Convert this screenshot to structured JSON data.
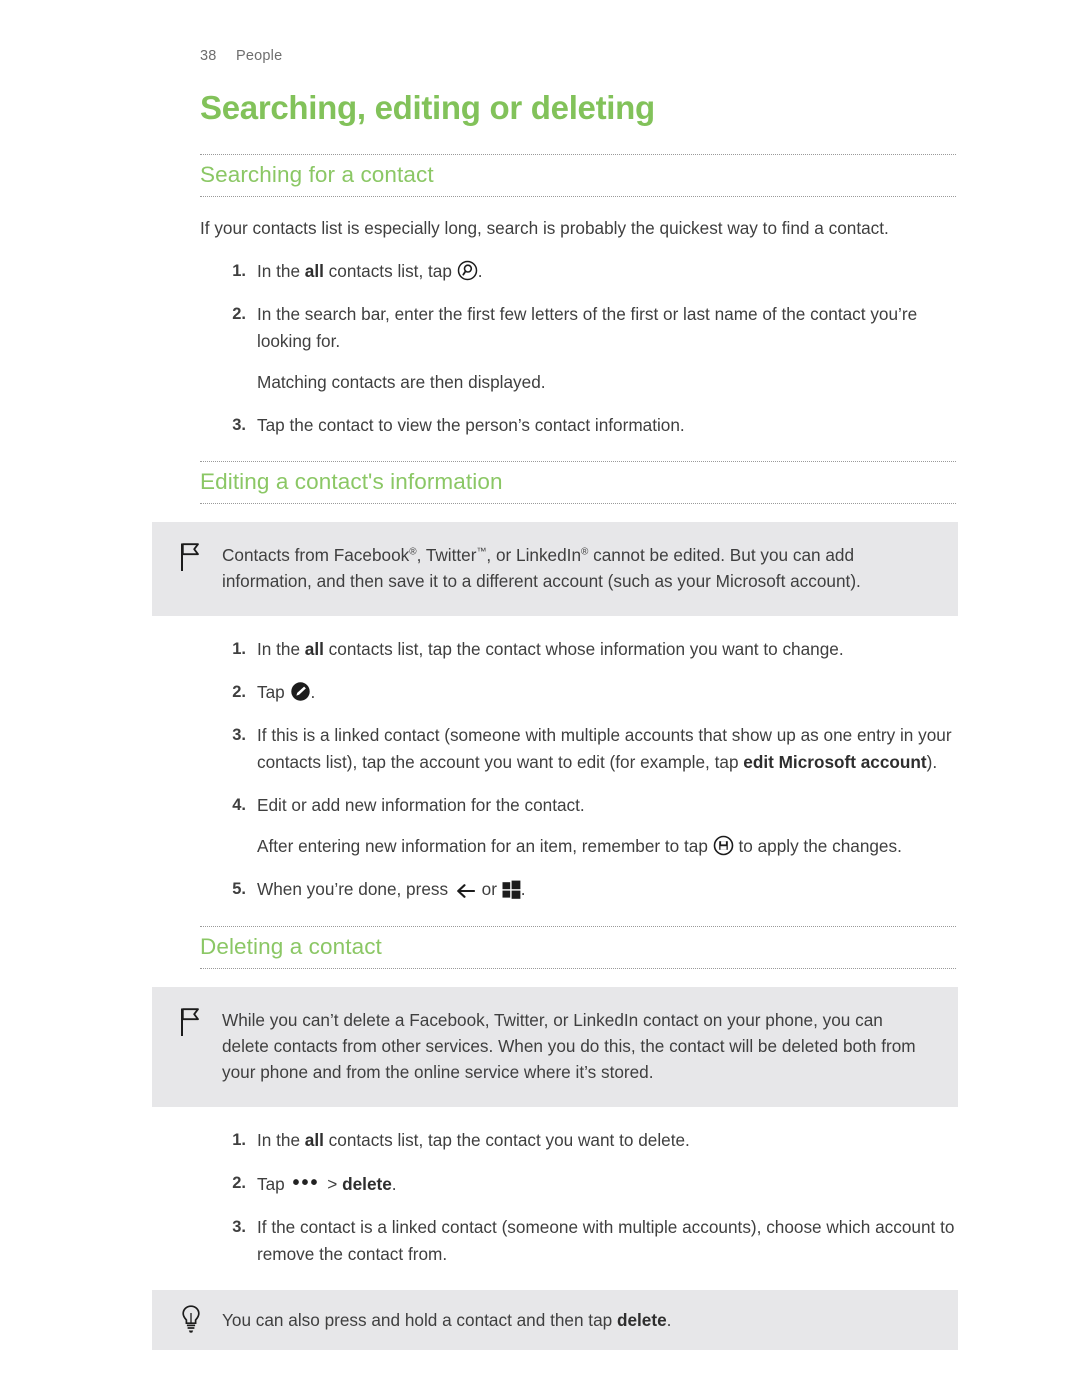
{
  "page": {
    "number": "38",
    "chapter": "People"
  },
  "title": "Searching, editing or deleting",
  "colors": {
    "heading_green": "#82c25a",
    "subheading_green": "#8bc765",
    "callout_bg": "#e7e7e9",
    "body_text": "#3f3f3f",
    "rule": "#9a9a9a"
  },
  "sections": [
    {
      "heading": "Searching for a contact",
      "intro": "If your contacts list is especially long, search is probably the quickest way to find a contact.",
      "steps": [
        {
          "num": "1.",
          "pre": "In the ",
          "bold": "all",
          "mid": " contacts list, tap ",
          "icon": "search-circle-icon",
          "post": "."
        },
        {
          "num": "2.",
          "text": "In the search bar, enter the first few letters of the first or last name of the contact you’re looking for.",
          "substep": "Matching contacts are then displayed."
        },
        {
          "num": "3.",
          "text": "Tap the contact to view the person’s contact information."
        }
      ]
    },
    {
      "heading": "Editing a contact's information",
      "note": {
        "icon": "flag-icon",
        "text_parts": {
          "a": "Contacts from Facebook",
          "sup1": "®",
          "b": ", Twitter",
          "sup2": "™",
          "c": ", or LinkedIn",
          "sup3": "®",
          "d": " cannot be edited. But you can add information, and then save it to a different account (such as your Microsoft account)."
        }
      },
      "steps": [
        {
          "num": "1.",
          "pre": "In the ",
          "bold": "all",
          "post": " contacts list, tap the contact whose information you want to change."
        },
        {
          "num": "2.",
          "pre": "Tap ",
          "icon": "edit-pencil-circle-icon",
          "post": "."
        },
        {
          "num": "3.",
          "pre": "If this is a linked contact (someone with multiple accounts that show up as one entry in your contacts list), tap the account you want to edit (for example, tap ",
          "bold": "edit Microsoft account",
          "post": ")."
        },
        {
          "num": "4.",
          "text": "Edit or add new information for the contact.",
          "substep_pre": "After entering new information for an item, remember to tap ",
          "substep_icon": "save-disk-circle-icon",
          "substep_post": " to apply the changes."
        },
        {
          "num": "5.",
          "pre": "When you’re done, press ",
          "icon_back": "back-arrow-icon",
          "mid": " or ",
          "icon_win": "windows-start-icon",
          "post": "."
        }
      ]
    },
    {
      "heading": "Deleting a contact",
      "note": {
        "icon": "flag-icon",
        "text": "While you can’t delete a Facebook, Twitter, or LinkedIn contact on your phone, you can delete contacts from other services. When you do this, the contact will be deleted both from your phone and from the online service where it’s stored."
      },
      "steps": [
        {
          "num": "1.",
          "pre": "In the ",
          "bold": "all",
          "post": " contacts list, tap the contact you want to delete."
        },
        {
          "num": "2.",
          "pre": "Tap ",
          "icon_ellipsis": "•••",
          "mid": " > ",
          "bold": "delete",
          "post": "."
        },
        {
          "num": "3.",
          "text": "If the contact is a linked contact (someone with multiple accounts), choose which account to remove the contact from."
        }
      ],
      "tip": {
        "icon": "lightbulb-icon",
        "pre": "You can also press and hold a contact and then tap ",
        "bold": "delete",
        "post": "."
      }
    }
  ]
}
